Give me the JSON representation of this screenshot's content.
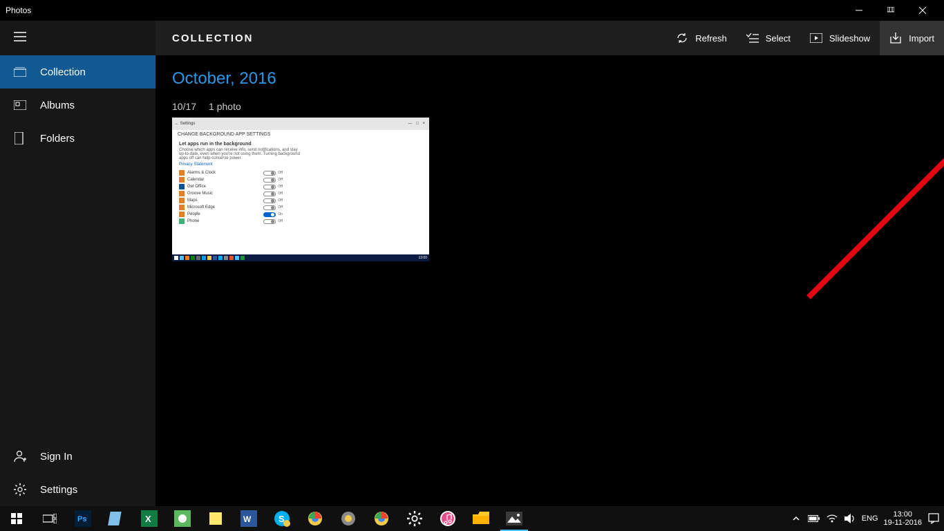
{
  "titlebar": {
    "title": "Photos"
  },
  "sidebar": {
    "items": [
      {
        "label": "Collection"
      },
      {
        "label": "Albums"
      },
      {
        "label": "Folders"
      }
    ],
    "bottom": [
      {
        "label": "Sign In"
      },
      {
        "label": "Settings"
      }
    ]
  },
  "toolbar": {
    "title": "COLLECTION",
    "refresh": "Refresh",
    "select": "Select",
    "slideshow": "Slideshow",
    "import": "Import"
  },
  "collection": {
    "month": "October, 2016",
    "date": "10/17",
    "count": "1 photo"
  },
  "thumb": {
    "topbar_left": "←  Settings",
    "header": "CHANGE BACKGROUND APP SETTINGS",
    "subtitle": "Let apps run in the background",
    "desc1": "Choose which apps can receive info, send notifications, and stay",
    "desc2": "up-to-date, even when you're not using them. Turning background",
    "desc3": "apps off can help conserve power.",
    "privacy": "Privacy Statement",
    "rows": [
      {
        "name": "Alarms & Clock",
        "color": "#e67e22",
        "on": false,
        "state": "Off"
      },
      {
        "name": "Calendar",
        "color": "#e67e22",
        "on": false,
        "state": "Off"
      },
      {
        "name": "Get Office",
        "color": "#0b5394",
        "on": false,
        "state": "Off"
      },
      {
        "name": "Groove Music",
        "color": "#e67e22",
        "on": false,
        "state": "Off"
      },
      {
        "name": "Maps",
        "color": "#e67e22",
        "on": false,
        "state": "Off"
      },
      {
        "name": "Microsoft Edge",
        "color": "#e67e22",
        "on": false,
        "state": "Off"
      },
      {
        "name": "People",
        "color": "#e67e22",
        "on": true,
        "state": "On"
      },
      {
        "name": "Phone",
        "color": "#3cb371",
        "on": false,
        "state": "Off"
      }
    ]
  },
  "tray": {
    "lang": "ENG",
    "time": "13:00",
    "date": "19-11-2016"
  },
  "annotation": {
    "type": "red-arrow",
    "points_to": "import-button"
  }
}
